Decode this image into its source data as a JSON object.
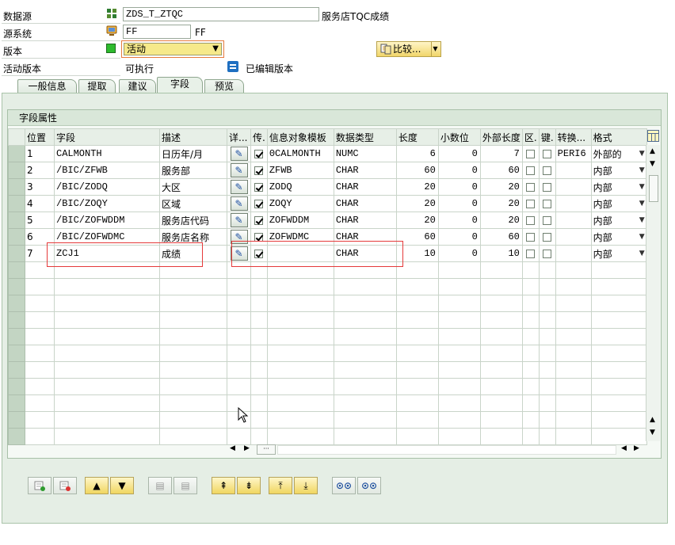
{
  "header": {
    "datasource_label": "数据源",
    "datasource_value": "ZDS_T_ZTQC",
    "datasource_desc": "服务店TQC成绩",
    "sourcesystem_label": "源系统",
    "sourcesystem_value": "FF",
    "sourcesystem_desc": "FF",
    "version_label": "版本",
    "version_value": "活动",
    "compare_button": "比较...",
    "active_version_label": "活动版本",
    "active_version_value": "可执行",
    "edited_version_label": "已编辑版本"
  },
  "tabs": [
    {
      "label": "一般信息",
      "active": false
    },
    {
      "label": "提取",
      "active": false
    },
    {
      "label": "建议",
      "active": false
    },
    {
      "label": "字段",
      "active": true
    },
    {
      "label": "预览",
      "active": false
    }
  ],
  "group_title": "字段属性",
  "grid": {
    "columns": [
      "位置",
      "字段",
      "描述",
      "详...",
      "传.",
      "信息对象模板",
      "数据类型",
      "长度",
      "小数位",
      "外部长度",
      "区.",
      "键.",
      "转换...",
      "格式"
    ],
    "rows": [
      {
        "pos": "1",
        "field": "CALMONTH",
        "desc": "日历年/月",
        "transfer": true,
        "template": "0CALMONTH",
        "dtype": "NUMC",
        "length": "6",
        "decimals": "0",
        "extlen": "7",
        "conv": "PERI6",
        "format": "外部的"
      },
      {
        "pos": "2",
        "field": "/BIC/ZFWB",
        "desc": "服务部",
        "transfer": true,
        "template": "ZFWB",
        "dtype": "CHAR",
        "length": "60",
        "decimals": "0",
        "extlen": "60",
        "conv": "",
        "format": "内部"
      },
      {
        "pos": "3",
        "field": "/BIC/ZODQ",
        "desc": "大区",
        "transfer": true,
        "template": "ZODQ",
        "dtype": "CHAR",
        "length": "20",
        "decimals": "0",
        "extlen": "20",
        "conv": "",
        "format": "内部"
      },
      {
        "pos": "4",
        "field": "/BIC/ZOQY",
        "desc": "区域",
        "transfer": true,
        "template": "ZOQY",
        "dtype": "CHAR",
        "length": "20",
        "decimals": "0",
        "extlen": "20",
        "conv": "",
        "format": "内部"
      },
      {
        "pos": "5",
        "field": "/BIC/ZOFWDDM",
        "desc": "服务店代码",
        "transfer": true,
        "template": "ZOFWDDM",
        "dtype": "CHAR",
        "length": "20",
        "decimals": "0",
        "extlen": "20",
        "conv": "",
        "format": "内部"
      },
      {
        "pos": "6",
        "field": "/BIC/ZOFWDMC",
        "desc": "服务店名称",
        "transfer": true,
        "template": "ZOFWDMC",
        "dtype": "CHAR",
        "length": "60",
        "decimals": "0",
        "extlen": "60",
        "conv": "",
        "format": "内部"
      },
      {
        "pos": "7",
        "field": "ZCJ1",
        "desc": "成绩",
        "transfer": true,
        "template": "",
        "dtype": "CHAR",
        "length": "10",
        "decimals": "0",
        "extlen": "10",
        "conv": "",
        "format": "内部"
      }
    ],
    "empty_rows": 11
  }
}
